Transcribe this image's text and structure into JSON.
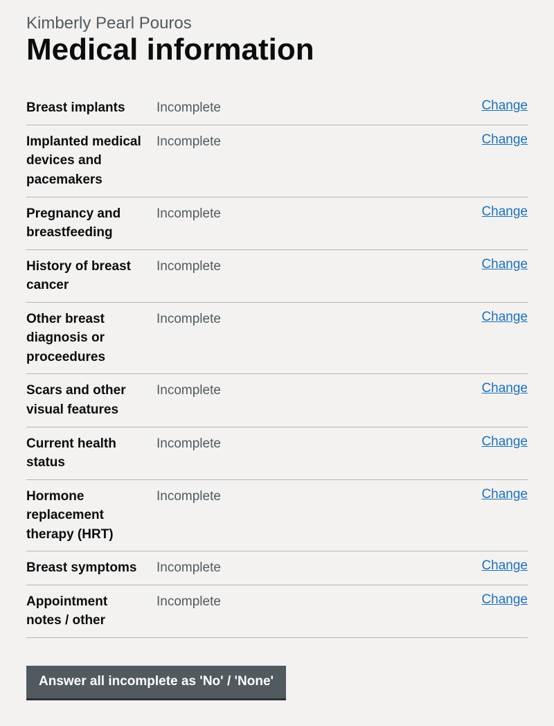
{
  "caption": "Kimberly Pearl Pouros",
  "heading": "Medical information",
  "change_label": "Change",
  "rows": [
    {
      "key": "Breast implants",
      "value": "Incomplete"
    },
    {
      "key": "Implanted medical devices and pacemakers",
      "value": "Incomplete"
    },
    {
      "key": "Pregnancy and breastfeeding",
      "value": "Incomplete"
    },
    {
      "key": "History of breast cancer",
      "value": "Incomplete"
    },
    {
      "key": "Other breast diagnosis or proceedures",
      "value": "Incomplete"
    },
    {
      "key": "Scars and other visual features",
      "value": "Incomplete"
    },
    {
      "key": "Current health status",
      "value": "Incomplete"
    },
    {
      "key": "Hormone replacement therapy (HRT)",
      "value": "Incomplete"
    },
    {
      "key": "Breast symptoms",
      "value": "Incomplete"
    },
    {
      "key": "Appointment notes / other",
      "value": "Incomplete"
    }
  ],
  "button_label": "Answer all incomplete as 'No' / 'None'"
}
